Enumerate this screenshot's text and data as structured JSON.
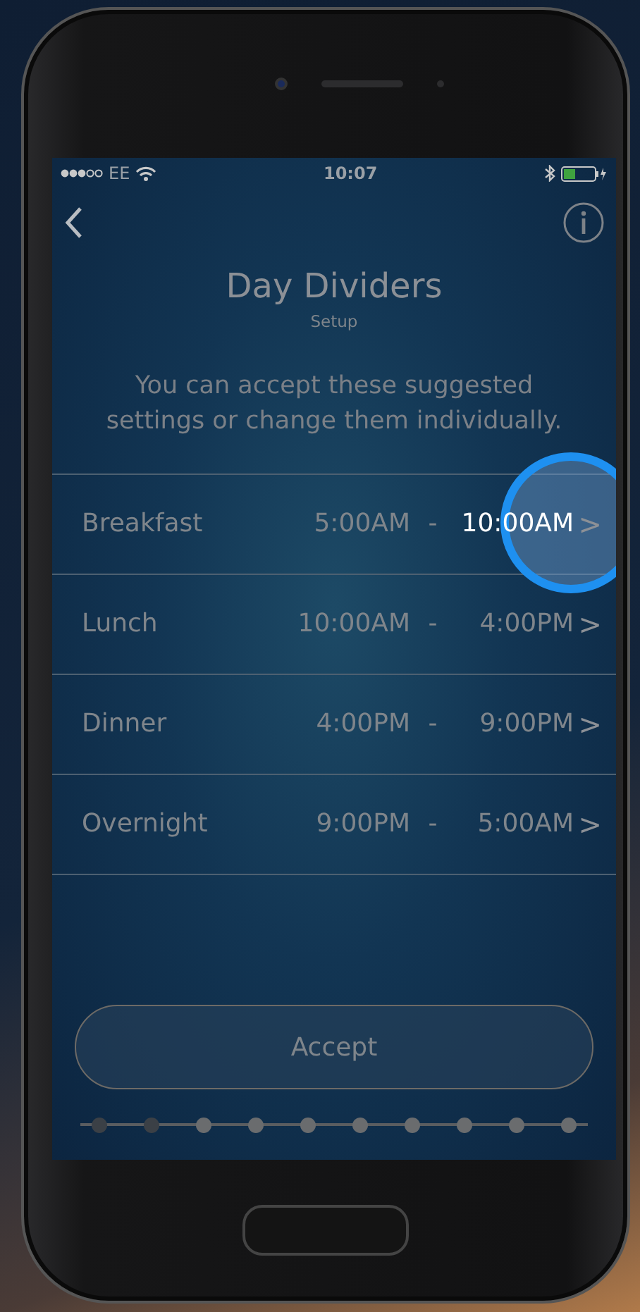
{
  "status_bar": {
    "carrier": "EE",
    "time": "10:07"
  },
  "header": {
    "title": "Day Dividers",
    "subtitle": "Setup"
  },
  "intro": "You can accept these suggested settings or change them individually.",
  "rows": [
    {
      "label": "Breakfast",
      "start": "5:00AM",
      "separator": "-",
      "end": "10:00AM",
      "chevron": ">",
      "highlighted": true
    },
    {
      "label": "Lunch",
      "start": "10:00AM",
      "separator": "-",
      "end": "4:00PM",
      "chevron": ">",
      "highlighted": false
    },
    {
      "label": "Dinner",
      "start": "4:00PM",
      "separator": "-",
      "end": "9:00PM",
      "chevron": ">",
      "highlighted": false
    },
    {
      "label": "Overnight",
      "start": "9:00PM",
      "separator": "-",
      "end": "5:00AM",
      "chevron": ">",
      "highlighted": false
    }
  ],
  "accept_button": "Accept",
  "progress_steps": [
    {
      "completed": true
    },
    {
      "completed": true
    },
    {
      "completed": false
    },
    {
      "completed": false
    },
    {
      "completed": false
    },
    {
      "completed": false
    },
    {
      "completed": false
    },
    {
      "completed": false
    },
    {
      "completed": false
    },
    {
      "completed": false
    }
  ]
}
